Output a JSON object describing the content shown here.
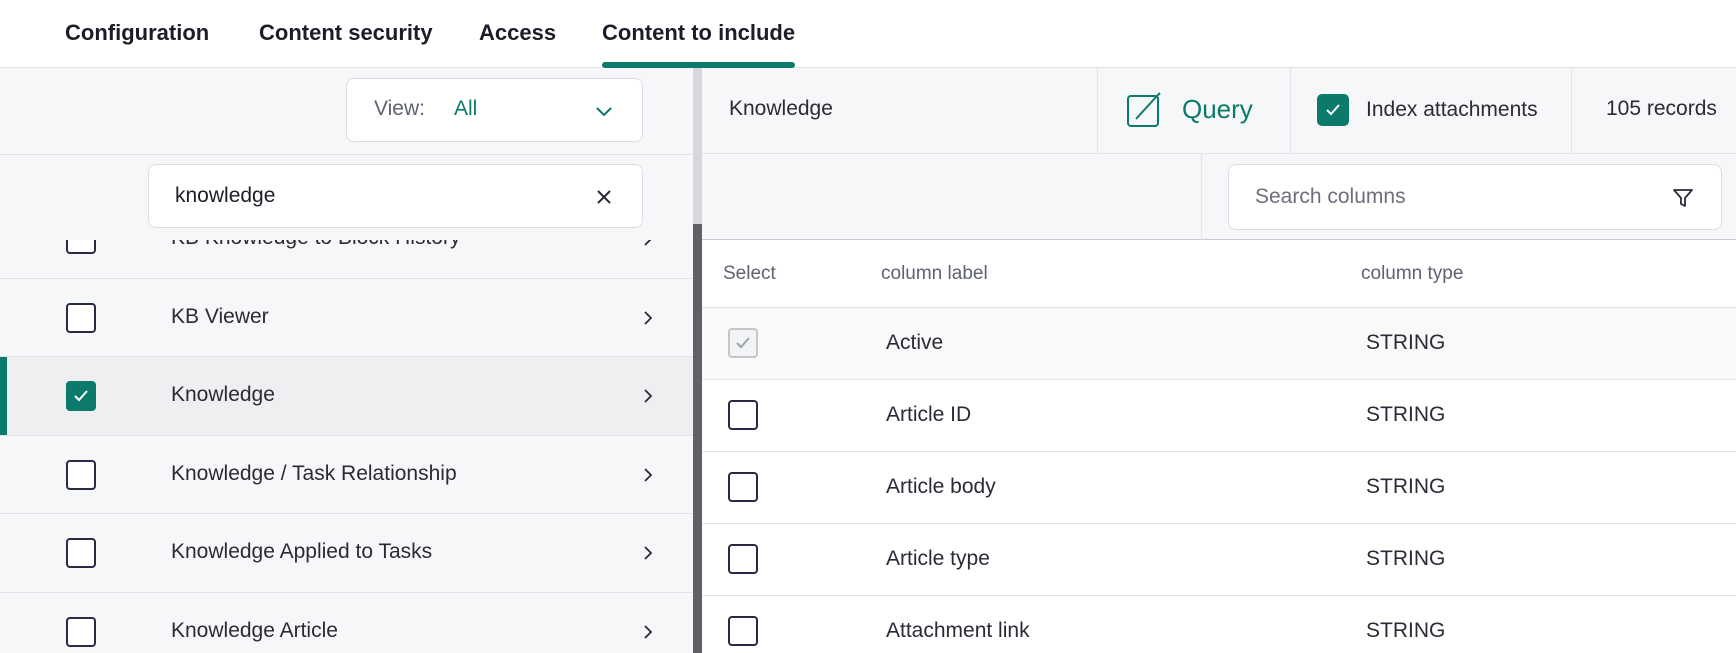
{
  "tabs": [
    {
      "label": "Configuration",
      "active": false
    },
    {
      "label": "Content security",
      "active": false
    },
    {
      "label": "Access",
      "active": false
    },
    {
      "label": "Content to include",
      "active": true
    }
  ],
  "left_panel": {
    "view": {
      "label": "View:",
      "value": "All"
    },
    "search": {
      "value": "knowledge"
    },
    "tables": [
      {
        "name": "KB Knowledge to Block History",
        "checked": false,
        "selected": false
      },
      {
        "name": "KB Viewer",
        "checked": false,
        "selected": false
      },
      {
        "name": "Knowledge",
        "checked": true,
        "selected": true
      },
      {
        "name": "Knowledge / Task Relationship",
        "checked": false,
        "selected": false
      },
      {
        "name": "Knowledge Applied to Tasks",
        "checked": false,
        "selected": false
      },
      {
        "name": "Knowledge Article",
        "checked": false,
        "selected": false
      }
    ]
  },
  "right_panel": {
    "table_name": "Knowledge",
    "query_label": "Query",
    "index_attachments": {
      "label": "Index attachments",
      "checked": true
    },
    "records": "105 records",
    "column_search_placeholder": "Search columns",
    "headers": {
      "select": "Select",
      "label": "column label",
      "type": "column type"
    },
    "columns": [
      {
        "label": "Active",
        "type": "STRING",
        "checked": true,
        "disabled": true
      },
      {
        "label": "Article ID",
        "type": "STRING",
        "checked": false,
        "disabled": false
      },
      {
        "label": "Article body",
        "type": "STRING",
        "checked": false,
        "disabled": false
      },
      {
        "label": "Article type",
        "type": "STRING",
        "checked": false,
        "disabled": false
      },
      {
        "label": "Attachment link",
        "type": "STRING",
        "checked": false,
        "disabled": false
      }
    ]
  },
  "colors": {
    "accent": "#0b7a6b",
    "text": "#2b2a36",
    "muted": "#5f6270",
    "panel_bg": "#f6f7f8"
  }
}
